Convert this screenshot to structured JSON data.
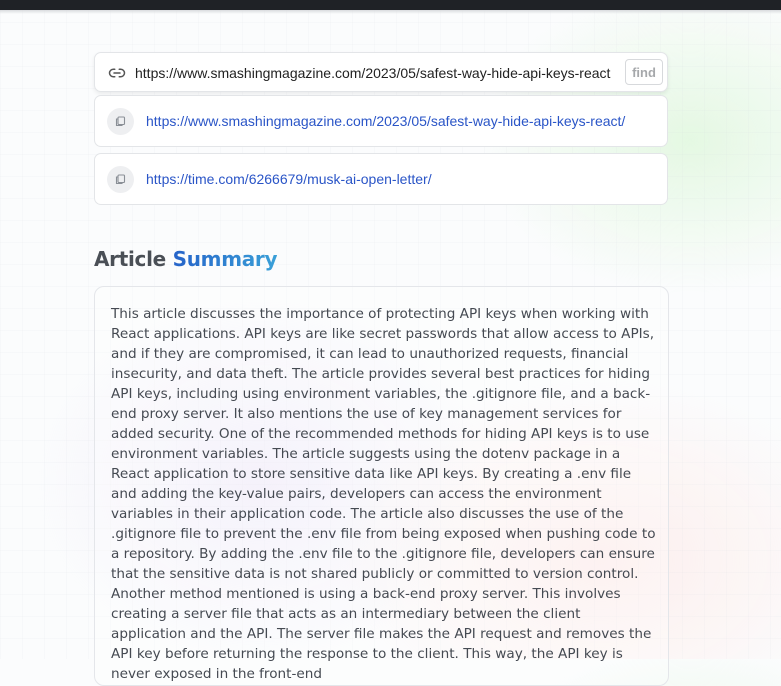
{
  "search": {
    "url_value": "https://www.smashingmagazine.com/2023/05/safest-way-hide-api-keys-react",
    "find_label": "find"
  },
  "history": [
    {
      "url": "https://www.smashingmagazine.com/2023/05/safest-way-hide-api-keys-react/"
    },
    {
      "url": "https://time.com/6266679/musk-ai-open-letter/"
    }
  ],
  "summary": {
    "heading_prefix": "Article",
    "heading_accent": "Summary",
    "body": "This article discusses the importance of protecting API keys when working with React applications. API keys are like secret passwords that allow access to APIs, and if they are compromised, it can lead to unauthorized requests, financial insecurity, and data theft. The article provides several best practices for hiding API keys, including using environment variables, the .gitignore file, and a back-end proxy server. It also mentions the use of key management services for added security. One of the recommended methods for hiding API keys is to use environment variables. The article suggests using the dotenv package in a React application to store sensitive data like API keys. By creating a .env file and adding the key-value pairs, developers can access the environment variables in their application code. The article also discusses the use of the .gitignore file to prevent the .env file from being exposed when pushing code to a repository. By adding the .env file to the .gitignore file, developers can ensure that the sensitive data is not shared publicly or committed to version control. Another method mentioned is using a back-end proxy server. This involves creating a server file that acts as an intermediary between the client application and the API. The server file makes the API request and removes the API key before returning the response to the client. This way, the API key is never exposed in the front-end"
  },
  "colors": {
    "accent": "#2563c9",
    "link": "#2a55c7"
  }
}
